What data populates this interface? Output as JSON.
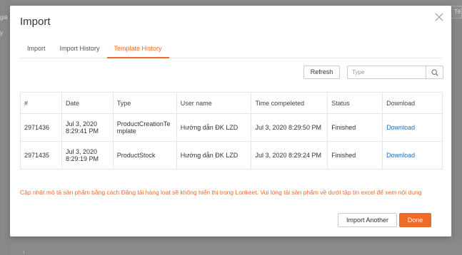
{
  "background": {
    "left_text_1": "giá",
    "left_text_2": "y",
    "right_tab_label": "Tê"
  },
  "modal": {
    "title": "Import",
    "tabs": [
      {
        "label": "Import",
        "active": false
      },
      {
        "label": "Import History",
        "active": false
      },
      {
        "label": "Template History",
        "active": true
      }
    ],
    "toolbar": {
      "refresh_label": "Refresh",
      "search_placeholder": "Type",
      "search_value": ""
    },
    "table": {
      "columns": [
        "#",
        "Date",
        "Type",
        "User name",
        "Time compeleted",
        "Status",
        "Download"
      ],
      "rows": [
        {
          "id": "2971436",
          "date_line1": "Jul 3, 2020",
          "date_line2": "8:29:41 PM",
          "type_line1": "ProductCreationTe",
          "type_line2": "mplate",
          "user": "Hướng dẫn ĐK LZD",
          "time_completed": "Jul 3, 2020 8:29:50 PM",
          "status": "Finished",
          "download": "Download"
        },
        {
          "id": "2971435",
          "date_line1": "Jul 3, 2020",
          "date_line2": "8:29:19 PM",
          "type_line1": "ProductStock",
          "type_line2": "",
          "user": "Hướng dẫn ĐK LZD",
          "time_completed": "Jul 3, 2020 8:29:24 PM",
          "status": "Finished",
          "download": "Download"
        }
      ]
    },
    "notice": "Cập nhật mô tả sản phẩm bằng cách Đăng tải hàng loạt sẽ không hiển thị trong Lonkeet. Vui lòng tải sản phẩm về dưới tập tin excel để xem nội dung",
    "footer": {
      "import_another_label": "Import Another",
      "done_label": "Done"
    }
  },
  "colors": {
    "accent": "#f06a27",
    "link": "#1a6ec2",
    "overlay": "#7f7f7f"
  }
}
